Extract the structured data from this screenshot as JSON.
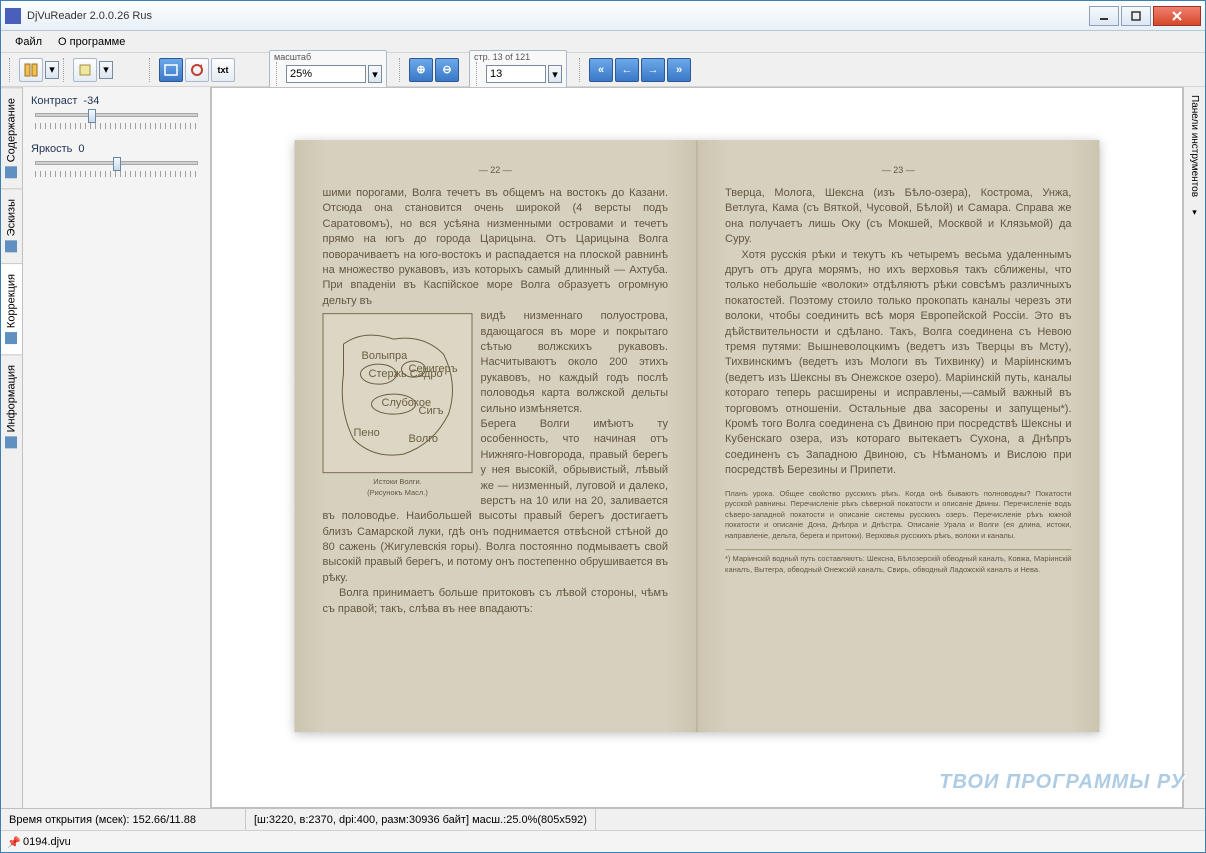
{
  "window": {
    "title": "DjVuReader 2.0.0.26 Rus"
  },
  "menu": {
    "file": "Файл",
    "about": "О программе"
  },
  "toolbar": {
    "zoom_label": "масштаб",
    "zoom_value": "25%",
    "page_label": "стр. 13 of 121",
    "page_value": "13"
  },
  "side": {
    "tabs": [
      "Содержание",
      "Эскизы",
      "Коррекция",
      "Информация"
    ],
    "contrast_label": "Контраст",
    "contrast_value": "-34",
    "brightness_label": "Яркость",
    "brightness_value": "0"
  },
  "right_panel": "Панели инструментов",
  "status": {
    "open_time": "Время открытия (мсек): 152.66/11.88",
    "info": "[ш:3220, в:2370, dpi:400, разм:30936 байт] масш.:25.0%(805x592)"
  },
  "filebar": {
    "name": "0194.djvu"
  },
  "watermark": "ТВОИ ПРОГРАММЫ РУ",
  "doc": {
    "left_num": "— 22 —",
    "right_num": "— 23 —",
    "left_p1": "шими порогами, Волга течетъ въ общемъ на востокъ до Казани. Отсюда она становится очень широкой (4 версты подъ Саратовомъ), но вся усѣяна низменными островами и течетъ прямо на югъ до города Царицына. Отъ Царицына Волга поворачиваетъ на юго-востокъ и распадается на плоской равнинѣ на множество рукавовъ, изъ которыхъ самый длинный — Ахтуба. При впаденіи въ Каспійское море Волга образуетъ огромную дельту въ",
    "left_p2": "видѣ низменнаго полуострова, вдающагося въ море и покрытаго сѣтью волжскихъ рукавовъ. Насчитываютъ около 200 этихъ рукавовъ, но каждый годъ послѣ половодья карта волжской дельты сильно измѣняется.",
    "left_p3": "Берега Волги имѣютъ ту особенность, что начиная отъ Нижняго-Новгорода, правый берегъ у нея высокій, обрывистый, лѣвый же — низменный, луговой и далеко, верстъ на 10 или на 20, заливается въ половодье. Наибольшей высоты правый берегъ достигаетъ близъ Самарской луки, гдѣ онъ поднимается отвѣсной стѣной до 80 сажень (Жигулевскія горы). Волга постоянно подмываетъ свой высокій правый берегъ, и потому онъ постепенно обрушивается въ рѣку.",
    "left_p4": "Волга принимаетъ больше притоковъ съ лѣвой стороны, чѣмъ съ правой; такъ, слѣва въ нее впадаютъ:",
    "map_caption": "Истоки Волги.\n(Рисунокъ Масл.)",
    "right_p1": "Тверца, Молога, Шексна (изъ Бѣло-озера), Кострома, Унжа, Ветлуга, Кама (съ Вяткой, Чусовой, Бѣлой) и Самара. Справа же она получаетъ лишь Оку (съ Мокшей, Москвой и Клязьмой) да Суру.",
    "right_p2": "Хотя русскія рѣки и текутъ къ четыремъ весьма удаленнымъ другъ отъ друга морямъ, но ихъ верховья такъ сближены, что только небольшіе «волоки» отдѣляютъ рѣки совсѣмъ различныхъ покатостей. Поэтому стоило только прокопать каналы черезъ эти волоки, чтобы соединить всѣ моря Европейской Россіи. Это въ дѣйствительности и сдѣлано. Такъ, Волга соединена съ Невою тремя путями: Вышневолоцкимъ (ведетъ изъ Тверцы въ Мсту), Тихвинскимъ (ведетъ изъ Мологи въ Тихвинку) и Маріинскимъ (ведетъ изъ Шексны въ Онежское озеро). Маріинскій путь, каналы котораго теперь расширены и исправлены,—самый важный въ торговомъ отношеніи. Остальные два засорены и запущены*). Кромѣ того Волга соединена съ Двиною при посредствѣ Шексны и Кубенскаго озера, изъ котораго вытекаетъ Сухона, а Днѣпръ соединенъ съ Западною Двиною, съ Нѣманомъ и Вислою при посредствѣ Березины и Припети.",
    "plan": "Планъ урока. Общее свойство русскихъ рѣкъ. Когда онѣ бываютъ полноводны? Покатости русской равнины. Перечисленіе рѣкъ сѣверной покатости и описаніе Двины. Перечисленіе водъ сѣверо-западной покатости и описаніе системы русскихъ озеръ. Перечисленіе рѣкъ южной покатости и описаніе Дона, Днѣпра и Днѣстра. Описаніе Урала и Волги (ея длина, истоки, направленіе, дельта, берега и притоки). Верховья русскихъ рѣкъ, волоки и каналы.",
    "footnote": "*) Маріинскій водный путь составляютъ: Шексна, Бѣлозерскій обводный каналъ, Ковжа, Маріинскій каналъ, Вытегра, обводный Онежскій каналъ, Свирь, обводный Ладожскій каналъ и Нева."
  }
}
